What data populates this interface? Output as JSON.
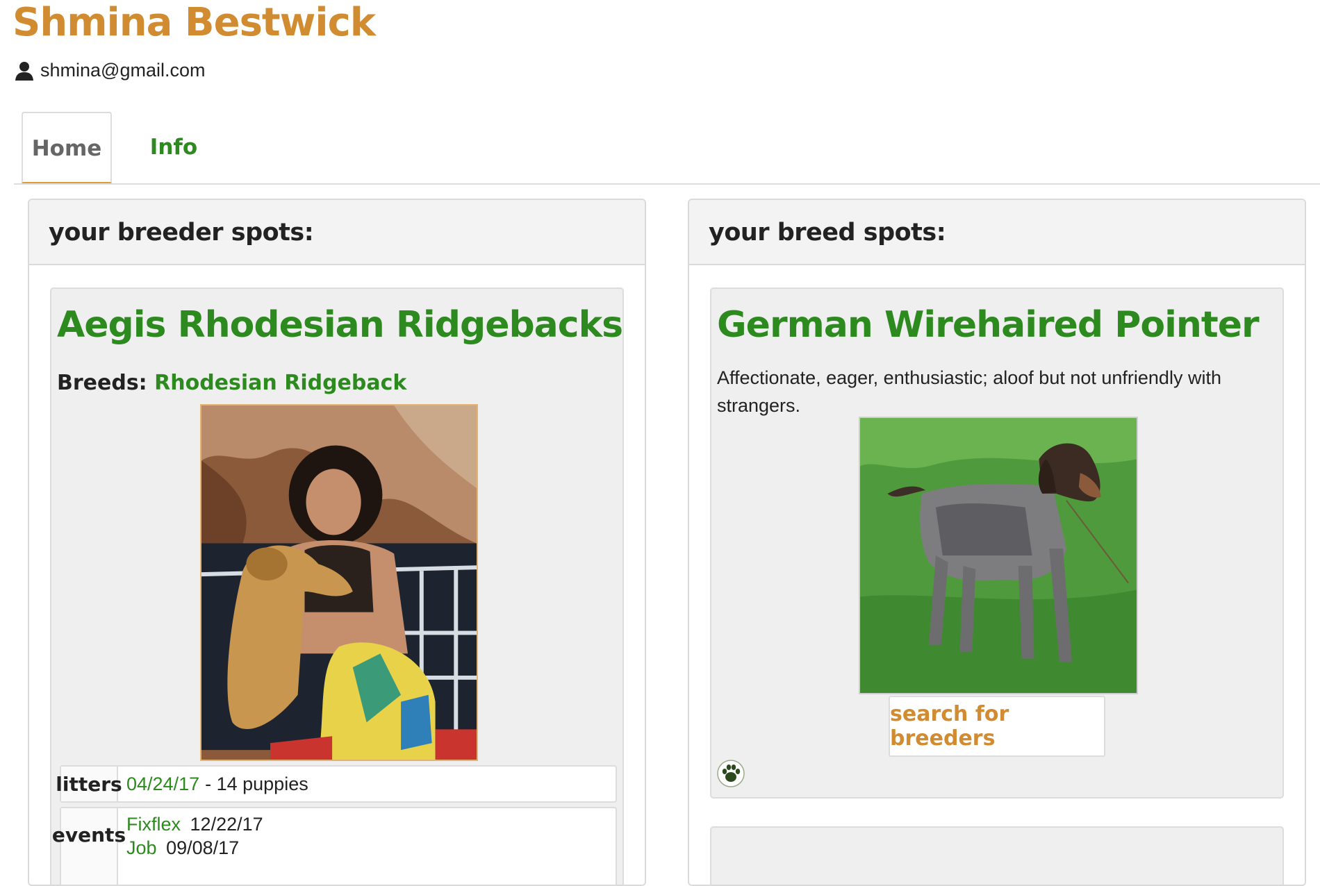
{
  "user": {
    "name": "Shmina Bestwick",
    "email": "shmina@gmail.com",
    "email_icon": "user-icon"
  },
  "tabs": [
    {
      "label": "Home",
      "active": true
    },
    {
      "label": "Info",
      "active": false
    }
  ],
  "left_panel": {
    "title": "your breeder spots:",
    "breeder": {
      "name": "Aegis Rhodesian Ridgebacks",
      "breeds_label": "Breeds:",
      "breed": "Rhodesian Ridgeback",
      "litters_label": "litters",
      "litter_date": "04/24/17",
      "litter_count": "- 14 puppies",
      "events_label": "events",
      "events": [
        {
          "name": "Fixflex",
          "date": "12/22/17"
        },
        {
          "name": "Job",
          "date": "09/08/17"
        }
      ]
    }
  },
  "right_panel": {
    "title": "your breed spots:",
    "breed": {
      "name": "German Wirehaired Pointer",
      "description": "Affectionate, eager, enthusiastic; aloof but not unfriendly with strangers.",
      "search_label": "search for breeders",
      "paw_icon": "paw-icon"
    }
  },
  "colors": {
    "brand_orange": "#d18c32",
    "link_green": "#2c8a1f",
    "panel_header_bg": "#f3f3f3",
    "card_bg": "#efefef"
  }
}
